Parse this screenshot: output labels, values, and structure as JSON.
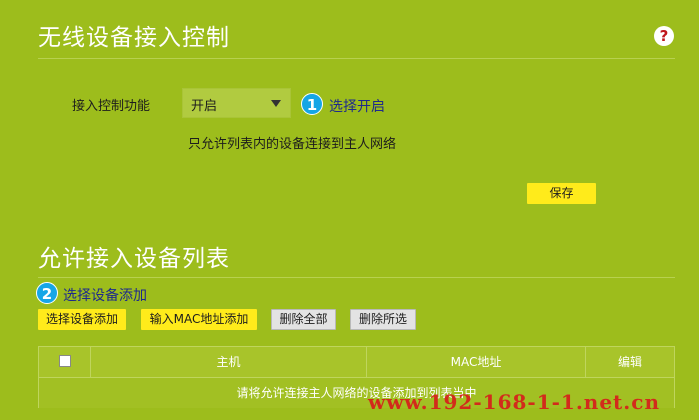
{
  "access_control": {
    "title": "无线设备接入控制",
    "function_label": "接入控制功能",
    "select_value": "开启",
    "step1_number": "1",
    "step1_text": "选择开启",
    "description": "只允许列表内的设备连接到主人网络",
    "save_label": "保存"
  },
  "allowed_list": {
    "title": "允许接入设备列表",
    "step2_number": "2",
    "step2_text": "选择设备添加",
    "buttons": {
      "select_add": "选择设备添加",
      "input_mac": "输入MAC地址添加",
      "delete_all": "删除全部",
      "delete_selected": "删除所选"
    },
    "table": {
      "headers": [
        "主机",
        "MAC地址",
        "编辑"
      ],
      "empty_message": "请将允许连接主人网络的设备添加到列表当中"
    }
  },
  "help_icon": "question-icon",
  "watermark": "www.192-168-1-1.net.cn",
  "colors": {
    "background": "#9dbd1c",
    "primary_button": "#ffeb1b",
    "badge": "#16a6e6"
  }
}
